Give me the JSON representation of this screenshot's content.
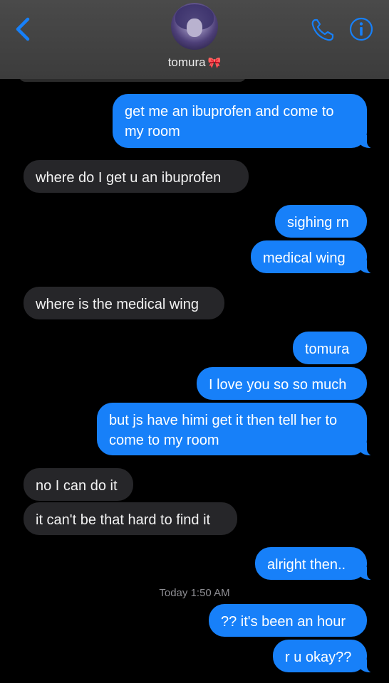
{
  "header": {
    "contact_name": "tomura",
    "contact_emoji": "🎀"
  },
  "messages": [
    {
      "from": "me",
      "text": "get me an ibuprofen and come to my room"
    },
    {
      "from": "them",
      "text": "where do I get u an ibuprofen"
    },
    {
      "from": "me",
      "text": "sighing rn"
    },
    {
      "from": "me",
      "text": "medical wing"
    },
    {
      "from": "them",
      "text": "where is the medical wing"
    },
    {
      "from": "me",
      "text": "tomura"
    },
    {
      "from": "me",
      "text": "I love you so so much"
    },
    {
      "from": "me",
      "text": "but js have himi get it then tell her to come to my room"
    },
    {
      "from": "them",
      "text": "no I can do it"
    },
    {
      "from": "them",
      "text": "it can't be that hard to find it"
    },
    {
      "from": "me",
      "text": "alright then.."
    },
    {
      "from": "me",
      "text": "?? it's been an hour"
    },
    {
      "from": "me",
      "text": "r u okay??"
    }
  ],
  "timestamp": {
    "day": "Today",
    "time": "1:50 AM"
  },
  "colors": {
    "outgoing": "#1780f9",
    "incoming": "#262629",
    "accent": "#1780f9"
  },
  "icons": [
    "back-chevron-icon",
    "phone-icon",
    "info-icon"
  ]
}
